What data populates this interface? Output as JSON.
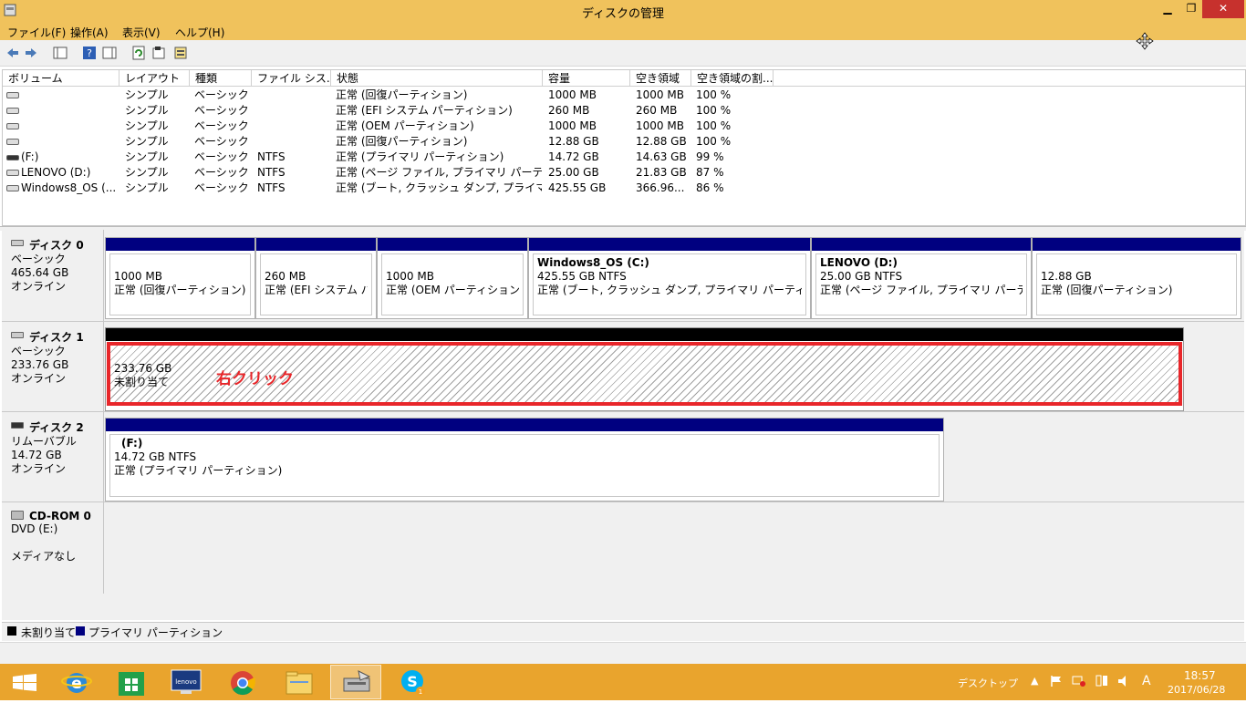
{
  "window": {
    "title": "ディスクの管理",
    "controls": {
      "minimize": "▁",
      "restore": "❐",
      "close": "✕"
    }
  },
  "menu": [
    {
      "label": "ファイル(F)"
    },
    {
      "label": "操作(A)"
    },
    {
      "label": "表示(V)"
    },
    {
      "label": "ヘルプ(H)"
    }
  ],
  "toolbar": {
    "icons": [
      "back-arrow-icon",
      "forward-arrow-icon",
      "console-tree-icon",
      "help-icon",
      "action-pane-icon",
      "refresh-icon",
      "properties-icon",
      "export-icon"
    ]
  },
  "volume_list": {
    "columns": [
      "ボリューム",
      "レイアウト",
      "種類",
      "ファイル シス...",
      "状態",
      "容量",
      "空き領域",
      "空き領域の割..."
    ],
    "rows": [
      {
        "volume": "",
        "layout": "シンプル",
        "type": "ベーシック",
        "fs": "",
        "status": "正常 (回復パーティション)",
        "capacity": "1000 MB",
        "free": "1000 MB",
        "pct": "100 %"
      },
      {
        "volume": "",
        "layout": "シンプル",
        "type": "ベーシック",
        "fs": "",
        "status": "正常 (EFI システム パーティション)",
        "capacity": "260 MB",
        "free": "260 MB",
        "pct": "100 %"
      },
      {
        "volume": "",
        "layout": "シンプル",
        "type": "ベーシック",
        "fs": "",
        "status": "正常 (OEM パーティション)",
        "capacity": "1000 MB",
        "free": "1000 MB",
        "pct": "100 %"
      },
      {
        "volume": "",
        "layout": "シンプル",
        "type": "ベーシック",
        "fs": "",
        "status": "正常 (回復パーティション)",
        "capacity": "12.88 GB",
        "free": "12.88 GB",
        "pct": "100 %"
      },
      {
        "volume": "(F:)",
        "layout": "シンプル",
        "type": "ベーシック",
        "fs": "NTFS",
        "status": "正常 (プライマリ パーティション)",
        "capacity": "14.72 GB",
        "free": "14.63 GB",
        "pct": "99 %"
      },
      {
        "volume": "LENOVO (D:)",
        "layout": "シンプル",
        "type": "ベーシック",
        "fs": "NTFS",
        "status": "正常 (ページ ファイル, プライマリ パーティション)",
        "capacity": "25.00 GB",
        "free": "21.83 GB",
        "pct": "87 %"
      },
      {
        "volume": "Windows8_OS (...",
        "layout": "シンプル",
        "type": "ベーシック",
        "fs": "NTFS",
        "status": "正常 (ブート, クラッシュ ダンプ, プライマリ パ...",
        "capacity": "425.55 GB",
        "free": "366.96...",
        "pct": "86 %"
      }
    ]
  },
  "disks": [
    {
      "name": "ディスク 0",
      "kind": "ベーシック",
      "size": "465.64 GB",
      "state": "オンライン",
      "partitions": [
        {
          "title": "",
          "size": "1000 MB",
          "status": "正常 (回復パーティション)"
        },
        {
          "title": "",
          "size": "260 MB",
          "status": "正常 (EFI システム パー"
        },
        {
          "title": "",
          "size": "1000 MB",
          "status": "正常 (OEM パーティション)"
        },
        {
          "title": "Windows8_OS  (C:)",
          "size": "425.55 GB NTFS",
          "status": "正常 (ブート, クラッシュ ダンプ, プライマリ パーティション)"
        },
        {
          "title": "LENOVO  (D:)",
          "size": "25.00 GB NTFS",
          "status": "正常 (ページ ファイル, プライマリ パーティション)"
        },
        {
          "title": "",
          "size": "12.88 GB",
          "status": "正常 (回復パーティション)"
        }
      ]
    },
    {
      "name": "ディスク 1",
      "kind": "ベーシック",
      "size": "233.76 GB",
      "state": "オンライン",
      "partitions": [
        {
          "title": "",
          "size": "233.76 GB",
          "status": "未割り当て"
        }
      ]
    },
    {
      "name": "ディスク 2",
      "kind": "リムーバブル",
      "size": "14.72 GB",
      "state": "オンライン",
      "partitions": [
        {
          "title": "(F:)",
          "size": "14.72 GB NTFS",
          "status": "正常 (プライマリ パーティション)"
        }
      ]
    },
    {
      "name": "CD-ROM 0",
      "kind": "DVD (E:)",
      "size": "",
      "state": "メディアなし",
      "partitions": []
    }
  ],
  "annotation": {
    "text": "右クリック",
    "color": "#e8262a"
  },
  "legend": [
    {
      "label": "未割り当て",
      "color": "#000000"
    },
    {
      "label": "プライマリ パーティション",
      "color": "#000080"
    }
  ],
  "taskbar": {
    "apps": [
      "windows-start-icon",
      "internet-explorer-icon",
      "store-icon",
      "lenovo-icon",
      "chrome-icon",
      "file-explorer-icon",
      "disk-management-icon",
      "skype-icon"
    ],
    "tray_label": "デスクトップ",
    "ime": "A",
    "time": "18:57",
    "date": "2017/06/28"
  },
  "colors": {
    "titlebar": "#f0c25c",
    "taskbar": "#e9a42d",
    "primary": "#000080"
  }
}
